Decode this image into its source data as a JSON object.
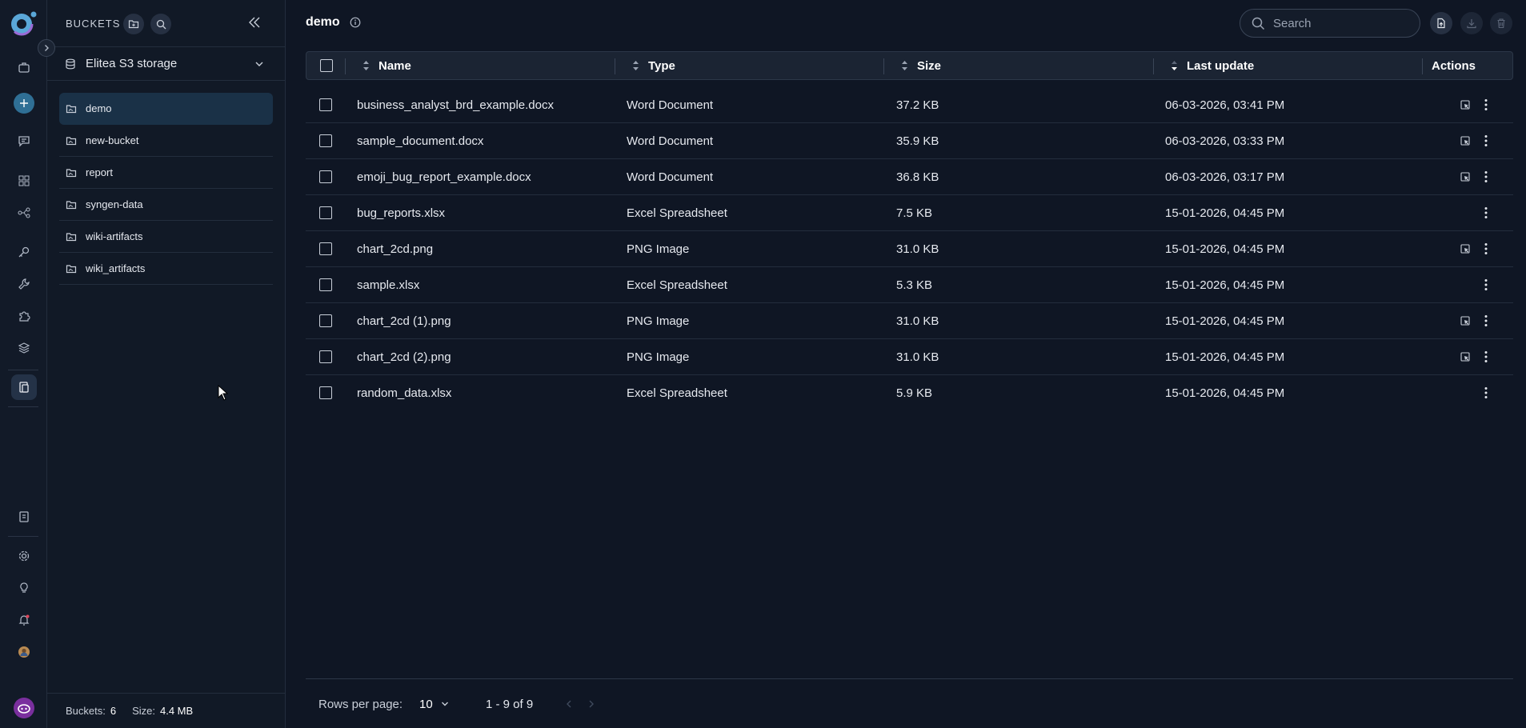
{
  "sidebar": {
    "icons": [
      "briefcase-icon",
      "add-icon",
      "chat-icon",
      "grid-icon",
      "pipeline-icon",
      "key-icon",
      "wrench-icon",
      "puzzle-icon",
      "layers-icon",
      "artifacts-icon",
      "book-icon",
      "settings-icon",
      "bulb-icon",
      "bell-icon",
      "avatar"
    ]
  },
  "buckets_panel": {
    "title": "BUCKETS",
    "storage": "Elitea S3 storage",
    "items": [
      {
        "label": "demo",
        "active": true
      },
      {
        "label": "new-bucket"
      },
      {
        "label": "report"
      },
      {
        "label": "syngen-data"
      },
      {
        "label": "wiki-artifacts"
      },
      {
        "label": "wiki_artifacts"
      }
    ],
    "footer": {
      "buckets_label": "Buckets:",
      "buckets_count": "6",
      "size_label": "Size:",
      "size_value": "4.4 MB"
    }
  },
  "main": {
    "title": "demo",
    "search": {
      "placeholder": "Search"
    },
    "columns": {
      "name": "Name",
      "type": "Type",
      "size": "Size",
      "last_update": "Last update",
      "actions": "Actions"
    },
    "rows": [
      {
        "name": "business_analyst_brd_example.docx",
        "type": "Word Document",
        "size": "37.2 KB",
        "updated": "06-03-2026, 03:41 PM",
        "preview": true
      },
      {
        "name": "sample_document.docx",
        "type": "Word Document",
        "size": "35.9 KB",
        "updated": "06-03-2026, 03:33 PM",
        "preview": true
      },
      {
        "name": "emoji_bug_report_example.docx",
        "type": "Word Document",
        "size": "36.8 KB",
        "updated": "06-03-2026, 03:17 PM",
        "preview": true
      },
      {
        "name": "bug_reports.xlsx",
        "type": "Excel Spreadsheet",
        "size": "7.5 KB",
        "updated": "15-01-2026, 04:45 PM",
        "preview": false
      },
      {
        "name": "chart_2cd.png",
        "type": "PNG Image",
        "size": "31.0 KB",
        "updated": "15-01-2026, 04:45 PM",
        "preview": true
      },
      {
        "name": "sample.xlsx",
        "type": "Excel Spreadsheet",
        "size": "5.3 KB",
        "updated": "15-01-2026, 04:45 PM",
        "preview": false
      },
      {
        "name": "chart_2cd (1).png",
        "type": "PNG Image",
        "size": "31.0 KB",
        "updated": "15-01-2026, 04:45 PM",
        "preview": true
      },
      {
        "name": "chart_2cd (2).png",
        "type": "PNG Image",
        "size": "31.0 KB",
        "updated": "15-01-2026, 04:45 PM",
        "preview": true
      },
      {
        "name": "random_data.xlsx",
        "type": "Excel Spreadsheet",
        "size": "5.9 KB",
        "updated": "15-01-2026, 04:45 PM",
        "preview": false
      }
    ],
    "pagination": {
      "rows_per_page_label": "Rows per page:",
      "rows_per_page": "10",
      "range": "1 - 9 of 9"
    }
  },
  "colors": {
    "background": "#0f1624",
    "active_bucket": "#1a3147",
    "accent": "#2f6f95"
  }
}
